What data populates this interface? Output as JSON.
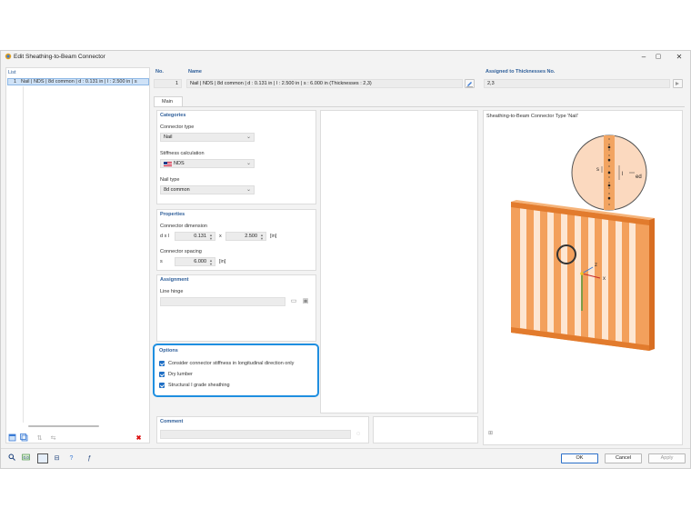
{
  "window": {
    "title": "Edit Sheathing-to-Beam Connector"
  },
  "list": {
    "header": "List",
    "items": [
      {
        "no": "1",
        "text": "Nail | NDS | 8d common | d : 0.131 in | l : 2.500 in | s"
      }
    ]
  },
  "header": {
    "no_label": "No.",
    "no_value": "1",
    "name_label": "Name",
    "name_value": "Nail | NDS | 8d common | d : 0.131 in | l : 2.500 in | s : 6.000 in (Thicknesses : 2,3)",
    "assigned_label": "Assigned to Thicknesses No.",
    "assigned_value": "2,3"
  },
  "tabs": [
    "Main"
  ],
  "categories": {
    "title": "Categories",
    "connector_type_label": "Connector type",
    "connector_type_value": "Nail",
    "stiffness_label": "Stiffness calculation",
    "stiffness_value": "NDS",
    "nail_type_label": "Nail type",
    "nail_type_value": "8d common"
  },
  "properties": {
    "title": "Properties",
    "dimension_label": "Connector dimension",
    "dl_label": "d x l",
    "d_value": "0.131",
    "x_label": "x",
    "l_value": "2.500",
    "dim_unit": "[in]",
    "spacing_label": "Connector spacing",
    "s_label": "s",
    "s_value": "6.000",
    "s_unit": "[in]"
  },
  "assignment": {
    "title": "Assignment",
    "line_hinge_label": "Line hinge"
  },
  "options": {
    "title": "Options",
    "items": [
      {
        "label": "Consider connector stiffness in longitudinal direction only",
        "checked": true
      },
      {
        "label": "Dry lumber",
        "checked": true
      },
      {
        "label": "Structural I grade sheathing",
        "checked": true
      }
    ]
  },
  "comment": {
    "title": "Comment"
  },
  "preview": {
    "title": "Sheathing-to-Beam Connector Type 'Nail'",
    "detail_labels": {
      "s": "s",
      "l": "l",
      "ed": "ed"
    },
    "axes": {
      "z": "z",
      "x": "x"
    }
  },
  "buttons": {
    "ok": "OK",
    "cancel": "Cancel",
    "apply": "Apply"
  },
  "colors": {
    "accent": "#1f6fc5",
    "wood": "#f08a3c",
    "wood_dark": "#d86e22",
    "highlight_border": "#1f8fe0"
  }
}
